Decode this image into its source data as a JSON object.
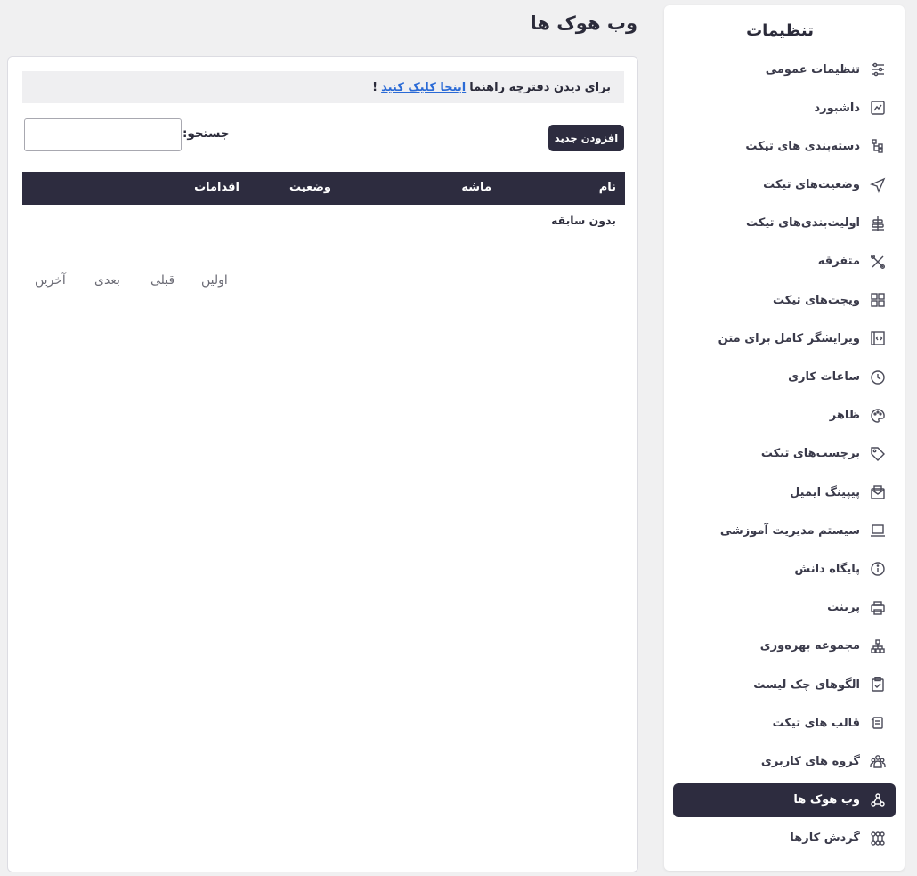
{
  "sidebar": {
    "title": "تنظیمات",
    "items": [
      {
        "label": "تنظیمات عمومی",
        "icon": "sliders-icon"
      },
      {
        "label": "داشبورد",
        "icon": "dashboard-chart-icon"
      },
      {
        "label": "دسته‌بندی های تیکت",
        "icon": "category-tree-icon"
      },
      {
        "label": "وضعیت‌های تیکت",
        "icon": "send-arrow-icon"
      },
      {
        "label": "اولیت‌بندی‌های تیکت",
        "icon": "priority-stack-icon"
      },
      {
        "label": "متفرقه",
        "icon": "tools-icon"
      },
      {
        "label": "ویجت‌های تیکت",
        "icon": "widgets-grid-icon"
      },
      {
        "label": "ویرایشگر کامل برای متن",
        "icon": "code-editor-icon"
      },
      {
        "label": "ساعات کاری",
        "icon": "clock-icon"
      },
      {
        "label": "ظاهر",
        "icon": "palette-icon"
      },
      {
        "label": "برچسب‌های تیکت",
        "icon": "tag-icon"
      },
      {
        "label": "پیپینگ ایمیل",
        "icon": "email-envelope-icon"
      },
      {
        "label": "سیستم مدیریت آموزشی",
        "icon": "laptop-icon"
      },
      {
        "label": "پایگاه دانش",
        "icon": "info-icon"
      },
      {
        "label": "پرینت",
        "icon": "printer-icon"
      },
      {
        "label": "مجموعه بهره‌وری",
        "icon": "hierarchy-icon"
      },
      {
        "label": "الگوهای چک لیست",
        "icon": "clipboard-check-icon"
      },
      {
        "label": "قالب های تیکت",
        "icon": "ticket-template-icon"
      },
      {
        "label": "گروه های کاربری",
        "icon": "user-group-icon"
      },
      {
        "label": "وب هوک ها",
        "icon": "webhook-icon",
        "active": true
      },
      {
        "label": "گردش کارها",
        "icon": "workflow-icon"
      }
    ]
  },
  "header": {
    "title": "وب هوک ها"
  },
  "main": {
    "notice": {
      "text": "برای دیدن دفترچه راهنما",
      "link": "اینجا کلیک کنید",
      "suffix": "!"
    },
    "add_button": "افزودن جدید",
    "search_label": "جستجو:",
    "search_value": "",
    "table": {
      "columns": [
        "نام",
        "ماشه",
        "وضعیت",
        "اقدامات"
      ],
      "empty_text": "بدون سابقه"
    },
    "pagination": {
      "first": "اولین",
      "prev": "قبلی",
      "next": "بعدی",
      "last": "آخرین"
    }
  },
  "colors": {
    "accent": "#2d2c3f",
    "link": "#2a6ad6",
    "background": "#f0f0f1"
  }
}
